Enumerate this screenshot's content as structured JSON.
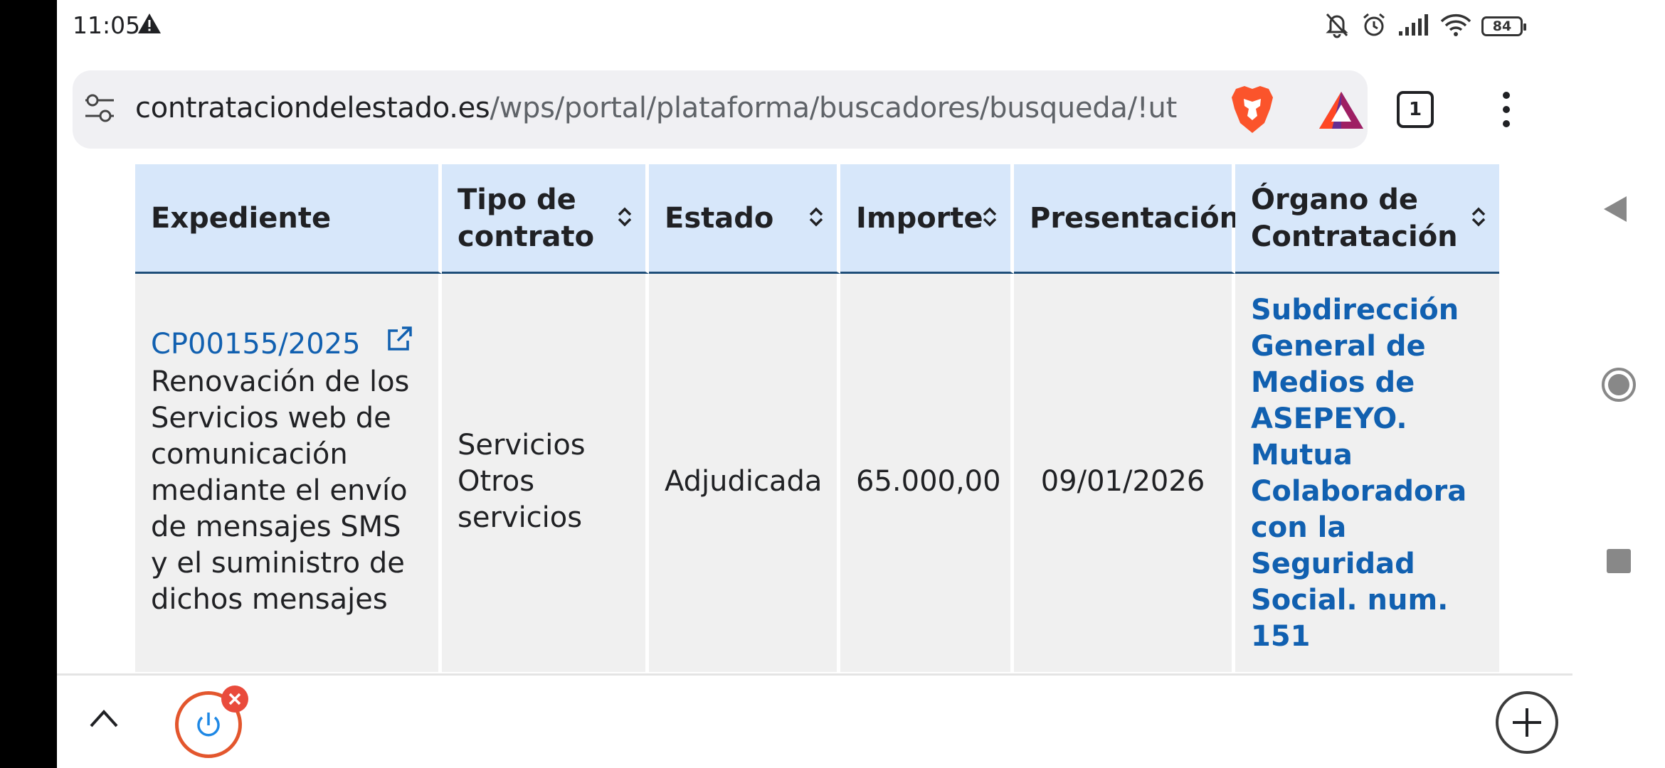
{
  "status_bar": {
    "time": "11:05",
    "battery": "84",
    "icons": [
      "warning-icon",
      "mute-icon",
      "alarm-icon",
      "signal-icon",
      "wifi-icon",
      "battery-icon"
    ]
  },
  "browser": {
    "url_domain": "contrataciondelestado.es",
    "url_path": "/wps/portal/plataforma/buscadores/busqueda/!ut",
    "tab_count": "1"
  },
  "table": {
    "headers": [
      {
        "label": "Expediente",
        "sortable": false
      },
      {
        "label": "Tipo de contrato",
        "sortable": true
      },
      {
        "label": "Estado",
        "sortable": true
      },
      {
        "label": "Importe",
        "sortable": true
      },
      {
        "label": "Presentación",
        "sortable": false
      },
      {
        "label": "Órgano de Contratación",
        "sortable": true
      }
    ],
    "rows": [
      {
        "expediente_id": "CP00155/2025",
        "expediente_desc": "Renovación de los Servicios web de comunicación mediante el envío de mensajes SMS y el suministro de dichos mensajes",
        "tipo_contrato": "Servicios Otros servicios",
        "estado": "Adjudicada",
        "importe": "65.000,00",
        "presentacion": "09/01/2026",
        "organo": "Subdirección General de Medios de ASEPEYO. Mutua Colaboradora con la Seguridad Social. num. 151"
      }
    ]
  },
  "colors": {
    "header_bg": "#d7e7fa",
    "row_bg": "#f0f0f0",
    "link": "#1160b0",
    "accent_orange": "#e3562d"
  }
}
